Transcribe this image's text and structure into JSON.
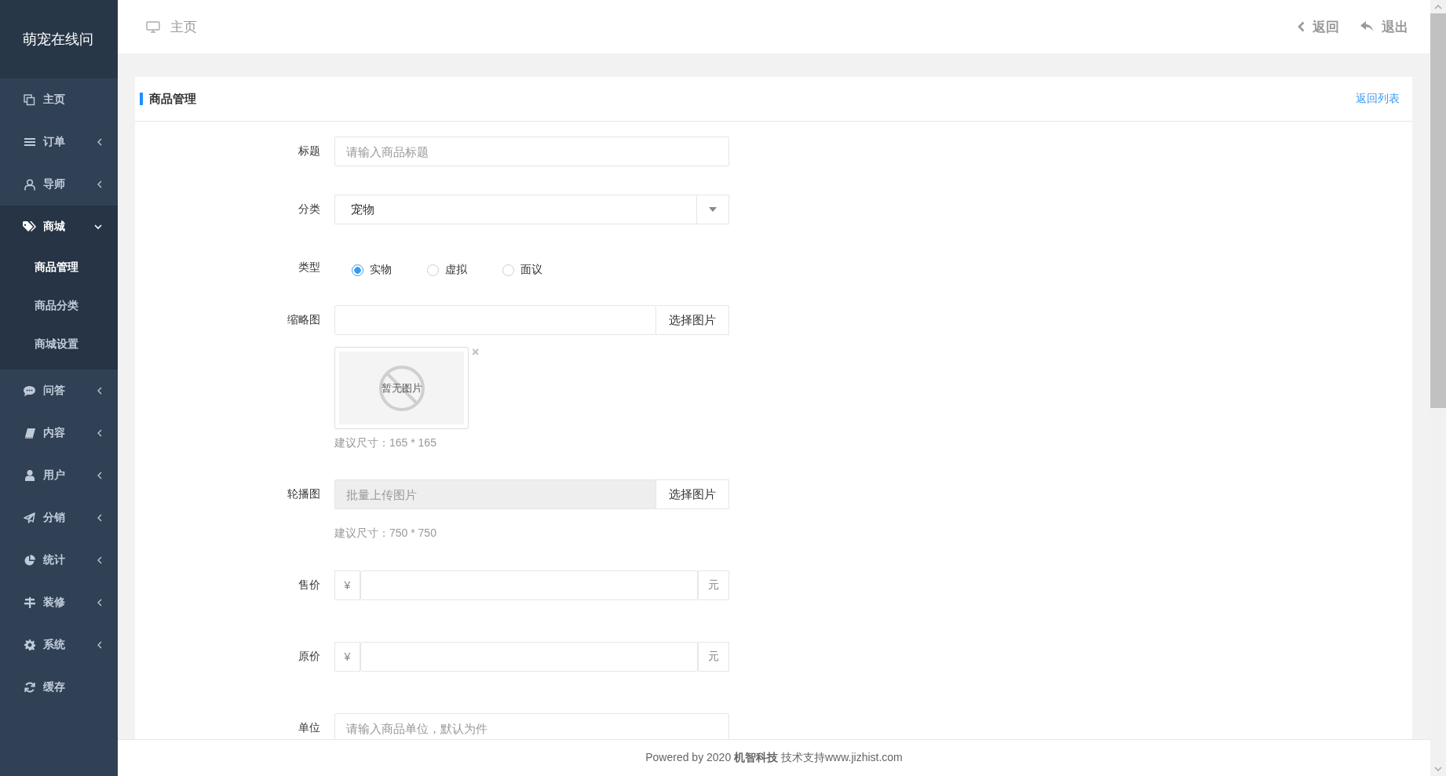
{
  "sidebar": {
    "brand": "萌宠在线问",
    "items": [
      {
        "label": "主页",
        "kind": "link",
        "expanded": false
      },
      {
        "label": "订单",
        "kind": "group",
        "expanded": false
      },
      {
        "label": "导师",
        "kind": "group",
        "expanded": false
      },
      {
        "label": "商城",
        "kind": "group",
        "expanded": true,
        "children": [
          {
            "label": "商品管理",
            "selected": true
          },
          {
            "label": "商品分类",
            "selected": false
          },
          {
            "label": "商城设置",
            "selected": false
          }
        ]
      },
      {
        "label": "问答",
        "kind": "group",
        "expanded": false
      },
      {
        "label": "内容",
        "kind": "group",
        "expanded": false
      },
      {
        "label": "用户",
        "kind": "group",
        "expanded": false
      },
      {
        "label": "分销",
        "kind": "group",
        "expanded": false
      },
      {
        "label": "统计",
        "kind": "group",
        "expanded": false
      },
      {
        "label": "装修",
        "kind": "group",
        "expanded": false
      },
      {
        "label": "系统",
        "kind": "group",
        "expanded": false
      },
      {
        "label": "缓存",
        "kind": "link",
        "expanded": false
      }
    ]
  },
  "header": {
    "breadcrumb": "主页",
    "actions": [
      "返回",
      "退出"
    ]
  },
  "panel": {
    "title": "商品管理",
    "link": "返回列表",
    "fields": [
      {
        "kind": "text",
        "label": "标题",
        "placeholder": "请输入商品标题"
      },
      {
        "kind": "select",
        "label": "分类",
        "value": "宠物"
      },
      {
        "kind": "radio",
        "label": "类型",
        "options": [
          {
            "label": "实物",
            "selected": true
          },
          {
            "label": "虚拟",
            "selected": false
          },
          {
            "label": "面议",
            "selected": false
          }
        ]
      },
      {
        "kind": "image",
        "label": "缩略图",
        "button": "选择图片",
        "preview_text": "暂无图片",
        "remove": "×",
        "hint": "建议尺寸：165 * 165"
      },
      {
        "kind": "upload",
        "label": "轮播图",
        "placeholder": "批量上传图片",
        "disabled": true,
        "button": "选择图片",
        "hint": "建议尺寸：750 * 750"
      },
      {
        "kind": "price",
        "label": "售价",
        "prefix": "¥",
        "suffix": "元"
      },
      {
        "kind": "price",
        "label": "原价",
        "prefix": "¥",
        "suffix": "元"
      },
      {
        "kind": "text",
        "label": "单位",
        "placeholder": "请输入商品单位，默认为件"
      }
    ]
  },
  "footer": "Powered by 2020 **机智科技** 技术支持www.jizhist.com"
}
